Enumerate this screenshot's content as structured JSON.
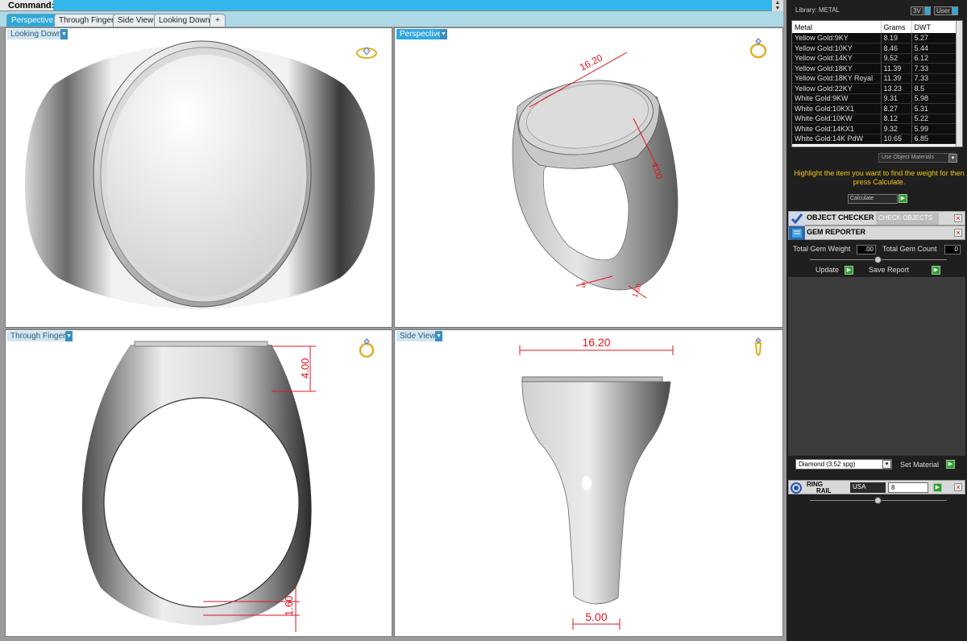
{
  "command": {
    "label": "Command:",
    "value": ""
  },
  "tabs": [
    {
      "label": "Perspective",
      "active": true
    },
    {
      "label": "Through Finger"
    },
    {
      "label": "Side View"
    },
    {
      "label": "Looking Down"
    },
    {
      "label": "+"
    }
  ],
  "viewports": {
    "looking_down": {
      "label": "Looking Down"
    },
    "perspective": {
      "label": "Perspective",
      "dim_top": "16.20",
      "dim_side": "4.00",
      "dim_bot_a": "5",
      "dim_bot_b": "1.60"
    },
    "through_finger": {
      "label": "Through Finger",
      "dim_top": "4.00",
      "dim_bottom": "1.60"
    },
    "side_view": {
      "label": "Side View",
      "dim_top": "16.20",
      "dim_bottom": "5.00"
    }
  },
  "panel": {
    "library_title": "Library: METAL",
    "btn_3v": "3V",
    "btn_user": "User",
    "table_headers": [
      "Metal",
      "Grams",
      "DWT"
    ],
    "metals": [
      [
        "Yellow Gold:9KY",
        "8.19",
        "5.27"
      ],
      [
        "Yellow Gold:10KY",
        "8.46",
        "5.44"
      ],
      [
        "Yellow Gold:14KY",
        "9.52",
        "6.12"
      ],
      [
        "Yellow Gold:18KY",
        "11.39",
        "7.33"
      ],
      [
        "Yellow Gold:18KY Royal",
        "11.39",
        "7.33"
      ],
      [
        "Yellow Gold:22KY",
        "13.23",
        "8.5"
      ],
      [
        "White Gold:9KW",
        "9.31",
        "5.98"
      ],
      [
        "White Gold:10KX1",
        "8.27",
        "5.31"
      ],
      [
        "White Gold:10KW",
        "8.12",
        "5.22"
      ],
      [
        "White Gold:14KX1",
        "9.32",
        "5.99"
      ],
      [
        "White Gold:14K PdW",
        "10.65",
        "6.85"
      ]
    ],
    "use_object_materials": "Use Object Materials",
    "hint": "Highlight the item you want to find the weight for then press Calculate.",
    "calculate": "Calculate",
    "object_checker": {
      "title": "OBJECT CHECKER",
      "button": "CHECK OBJECTS"
    },
    "gem_reporter": {
      "title": "GEM REPORTER"
    },
    "total_gem_weight_label": "Total Gem Weight",
    "total_gem_weight": ".00",
    "total_gem_count_label": "Total Gem Count",
    "total_gem_count": "0",
    "update": "Update",
    "save_report": "Save Report",
    "material_select": "Diamond    (3.52 spg)",
    "set_material": "Set Material",
    "ring_rail": {
      "title_1": "RING",
      "title_2": "RAIL",
      "region": "USA",
      "size": "8"
    }
  },
  "colors": {
    "accent": "#2ea8dc",
    "dimension": "#e0141e",
    "hint": "#f0c419"
  }
}
